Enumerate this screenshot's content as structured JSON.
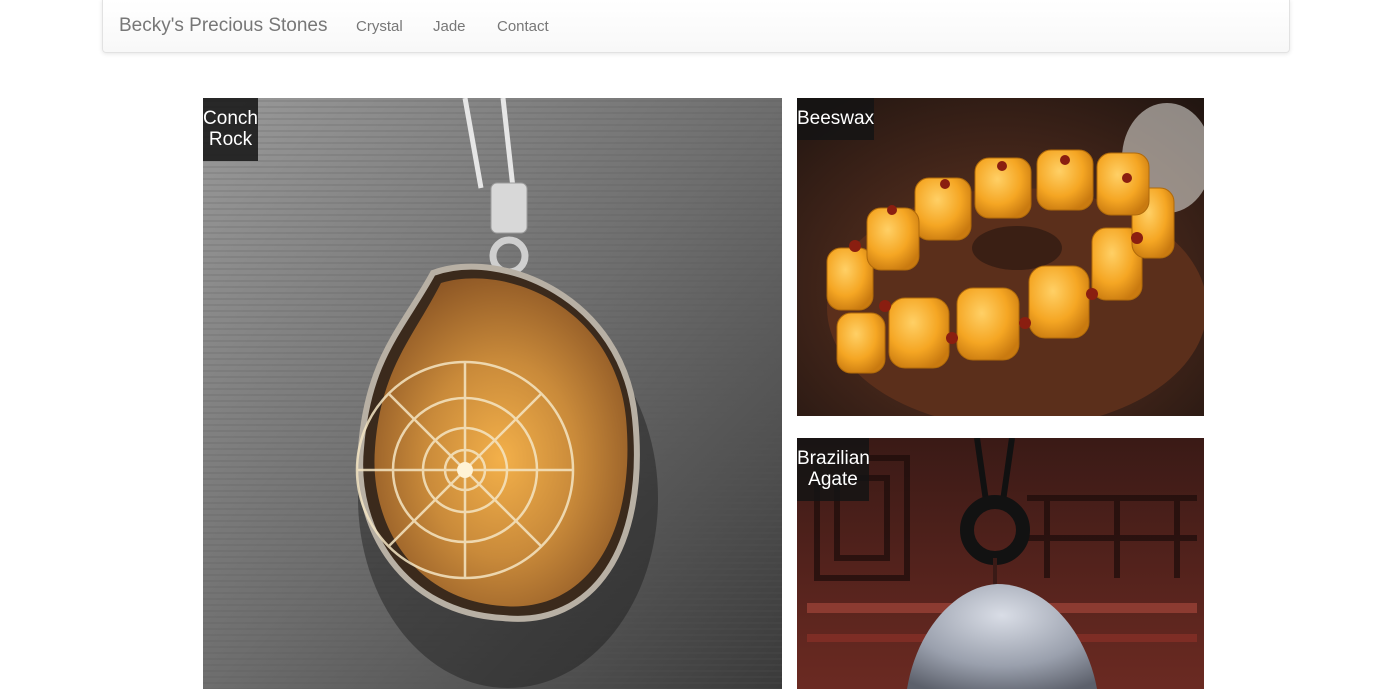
{
  "navbar": {
    "brand": "Becky's Precious Stones",
    "links": [
      "Crystal",
      "Jade",
      "Contact"
    ]
  },
  "gallery": [
    {
      "caption_lines": [
        "Conch",
        "Rock"
      ]
    },
    {
      "caption_lines": [
        "Beeswax"
      ]
    },
    {
      "caption_lines": [
        "Brazilian",
        "Agate"
      ]
    }
  ],
  "colors": {
    "nav_text": "#777777",
    "caption_bg": "#141414",
    "caption_text": "#ffffff"
  }
}
